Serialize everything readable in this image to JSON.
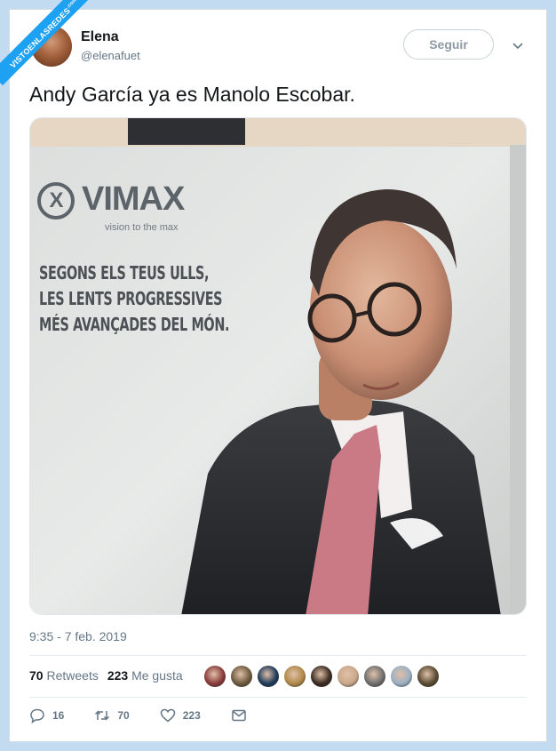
{
  "watermark": {
    "text": "VISTOENLASREDES",
    "suffix": ".com"
  },
  "author": {
    "name": "Elena",
    "handle": "@elenafuet"
  },
  "follow_button": {
    "label": "Seguir"
  },
  "tweet": {
    "text": "Andy García ya es Manolo Escobar."
  },
  "photo": {
    "brand": "VIMAX",
    "tagline": "vision to the max",
    "slogan": [
      "SEGONS ELS TEUS ULLS,",
      "LES LENTS PROGRESSIVES",
      "MÉS AVANÇADES DEL MÓN."
    ]
  },
  "meta": {
    "timestamp": "9:35 - 7 feb. 2019"
  },
  "stats": {
    "retweets_count": "70",
    "retweets_label": "Retweets",
    "likes_count": "223",
    "likes_label": "Me gusta"
  },
  "liker_avatar_colors": [
    "#8a3b3b",
    "#6d5a3e",
    "#1f3a5a",
    "#b08a4a",
    "#3b2b22",
    "#c9a88a",
    "#6f6f6f",
    "#9bb0c4",
    "#5a4a32"
  ],
  "actions": {
    "replies": "16",
    "retweets": "70",
    "likes": "223"
  },
  "colors": {
    "accent": "#1da1f2",
    "background": "#c3dbf0"
  }
}
